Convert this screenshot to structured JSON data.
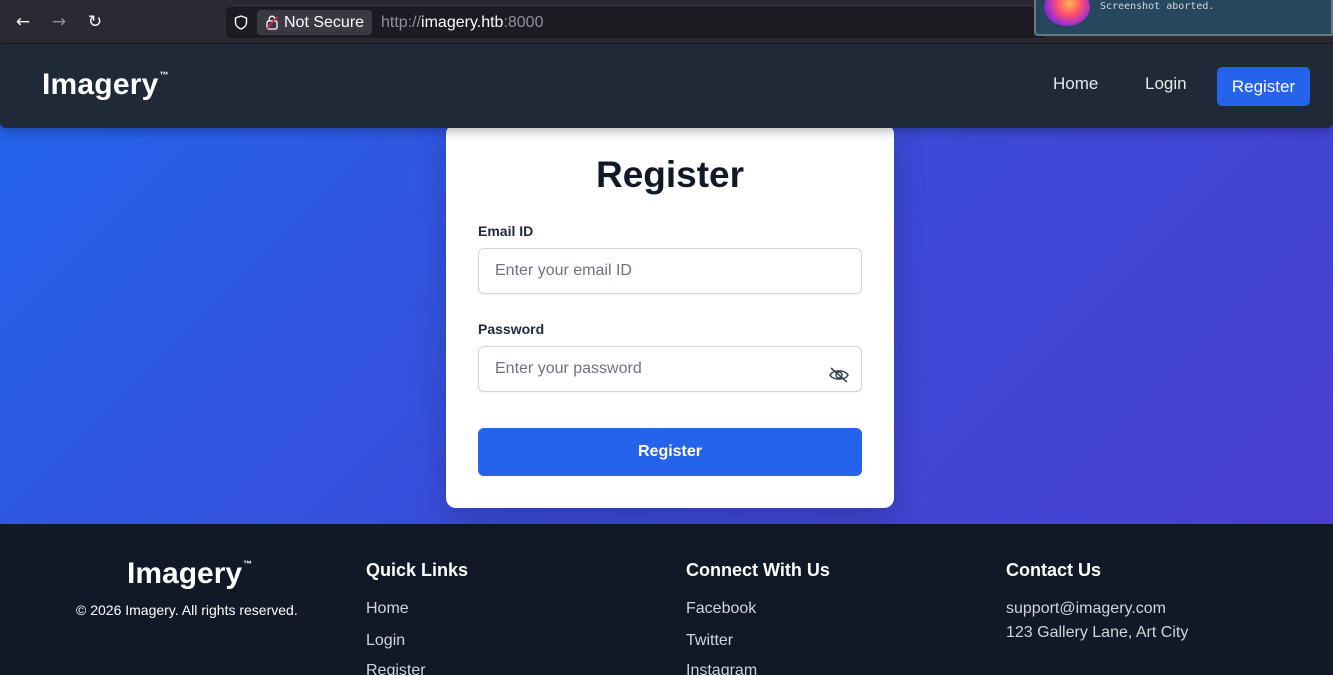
{
  "browser": {
    "back_icon": "arrow-left-icon",
    "forward_icon": "arrow-right-icon",
    "reload_icon": "reload-icon",
    "security_label": "Not Secure",
    "url_scheme": "http://",
    "url_host": "imagery.htb",
    "url_port": ":8000"
  },
  "notification": {
    "text": "Screenshot aborted."
  },
  "header": {
    "brand": "Imagery",
    "brand_mark": "™",
    "nav": {
      "home": "Home",
      "login": "Login",
      "register": "Register"
    }
  },
  "form": {
    "title": "Register",
    "email_label": "Email ID",
    "email_placeholder": "Enter your email ID",
    "email_value": "",
    "password_label": "Password",
    "password_placeholder": "Enter your password",
    "password_value": "",
    "password_toggle_icon": "eye-slash-icon",
    "submit_label": "Register"
  },
  "footer": {
    "brand": "Imagery",
    "brand_mark": "™",
    "copyright": "© 2026 Imagery. All rights reserved.",
    "quick_links": {
      "heading": "Quick Links",
      "items": [
        "Home",
        "Login",
        "Register"
      ]
    },
    "connect": {
      "heading": "Connect With Us",
      "items": [
        "Facebook",
        "Twitter",
        "Instagram"
      ]
    },
    "contact": {
      "heading": "Contact Us",
      "email": "support@imagery.com",
      "address": "123 Gallery Lane, Art City"
    }
  },
  "colors": {
    "primary": "#2563eb",
    "header_bg": "#1f2937",
    "footer_bg": "#111827",
    "hero_gradient_start": "#2563eb",
    "hero_gradient_end": "#4a3fd0"
  }
}
